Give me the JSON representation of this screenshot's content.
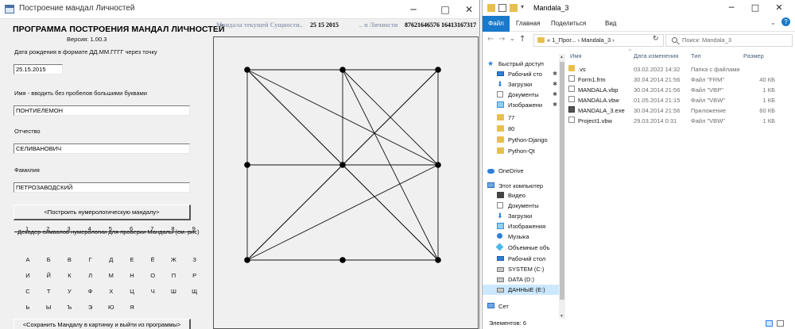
{
  "vb_window": {
    "title": "Построение мандал Личностей",
    "controls": {
      "minimize": "─",
      "maximize": "□",
      "close": "✕"
    },
    "heading": "ПРОГРАММА ПОСТРОЕНИЯ МАНДАЛ ЛИЧНОСТЕЙ",
    "version": "Версия: 1.00.3",
    "birth_label": "Дата рождения в формате ДД.ММ.ГГГГ через точку",
    "birth_value": "25.15.2015",
    "name_label": "Имя - вводить без пробелов большими буквами",
    "name_value": "ПОНТИЕЛЕМОН",
    "patronymic_label": "Отчество",
    "patronymic_value": "СЕЛИВАНОВИЧ",
    "surname_label": "Фамилия",
    "surname_value": "ПЕТРОЗАВОДСКИЙ",
    "build_button": "<Построить нумерологическую мандалу>",
    "decoder_label": "Декодер символов нумерологии для проверки Мандалы (см. рис)",
    "digits": [
      "1",
      "2",
      "3",
      "4",
      "5",
      "6",
      "7",
      "8",
      "9"
    ],
    "letters": [
      "А",
      "Б",
      "В",
      "Г",
      "Д",
      "Е",
      "Ё",
      "Ж",
      "З",
      "И",
      "Й",
      "К",
      "Л",
      "М",
      "Н",
      "О",
      "П",
      "Р",
      "С",
      "Т",
      "У",
      "Ф",
      "Х",
      "Ц",
      "Ч",
      "Ш",
      "Щ",
      "Ь",
      "Ы",
      "Ъ",
      "Э",
      "Ю",
      "Я"
    ],
    "save_button": "<Сохранить Мандалу в картинку и выйти из программы>",
    "top_label_1": "Мандала текущей Сущности..",
    "top_value_1": "25 15 2015",
    "top_label_2": ".. и Личности",
    "top_value_2": "87621646576 16413167317"
  },
  "mandala": {
    "nodes": [
      [
        0,
        0
      ],
      [
        1,
        0
      ],
      [
        2,
        0
      ],
      [
        0,
        1
      ],
      [
        1,
        1
      ],
      [
        2,
        1
      ],
      [
        0,
        2
      ],
      [
        1,
        2
      ],
      [
        2,
        2
      ]
    ],
    "edges": [
      [
        0,
        1
      ],
      [
        1,
        2
      ],
      [
        0,
        3
      ],
      [
        3,
        6
      ],
      [
        1,
        4
      ],
      [
        3,
        4
      ],
      [
        4,
        5
      ],
      [
        6,
        7
      ],
      [
        7,
        8
      ],
      [
        2,
        5
      ],
      [
        5,
        8
      ],
      [
        0,
        4
      ],
      [
        0,
        5
      ],
      [
        0,
        8
      ],
      [
        1,
        5
      ],
      [
        1,
        8
      ],
      [
        2,
        6
      ],
      [
        2,
        4
      ],
      [
        4,
        6
      ],
      [
        6,
        5
      ],
      [
        4,
        8
      ]
    ]
  },
  "explorer": {
    "title": "Mandala_3",
    "controls": {
      "minimize": "─",
      "maximize": "□",
      "close": "✕"
    },
    "ribbon": {
      "file": "Файл",
      "home": "Главная",
      "share": "Поделиться",
      "view": "Вид"
    },
    "nav": {
      "back": "←",
      "forward": "→",
      "recent": "⌄",
      "up": "↑"
    },
    "address": "« 1_Прог...  ›  Mandala_3  ›",
    "search_placeholder": "Поиск: Mandala_3",
    "columns": {
      "name": "Имя",
      "date": "Дата изменения",
      "type": "Тип",
      "size": "Размер"
    },
    "files": [
      {
        "name": ".vs",
        "date": "03.02.2022 14:32",
        "type": "Папка с файлами",
        "size": "",
        "kind": "folder"
      },
      {
        "name": "Form1.frm",
        "date": "30.04.2014 21:56",
        "type": "Файл \"FRM\"",
        "size": "40 КБ",
        "kind": "file"
      },
      {
        "name": "MANDALA.vbp",
        "date": "30.04.2014 21:56",
        "type": "Файл \"VBP\"",
        "size": "1 КБ",
        "kind": "file"
      },
      {
        "name": "MANDALA.vbw",
        "date": "01.05.2014 21:15",
        "type": "Файл \"VBW\"",
        "size": "1 КБ",
        "kind": "file"
      },
      {
        "name": "MANDALA_3.exe",
        "date": "30.04.2014 21:56",
        "type": "Приложение",
        "size": "60 КБ",
        "kind": "exe"
      },
      {
        "name": "Project1.vbw",
        "date": "29.03.2014 0:31",
        "type": "Файл \"VBW\"",
        "size": "1 КБ",
        "kind": "file"
      }
    ],
    "nav_items": [
      {
        "label": "Быстрый доступ",
        "icon": "star"
      },
      {
        "label": "Рабочий сто",
        "icon": "desk",
        "pin": true
      },
      {
        "label": "Загрузки",
        "icon": "down",
        "pin": true
      },
      {
        "label": "Документы",
        "icon": "doc",
        "pin": true
      },
      {
        "label": "Изображени",
        "icon": "img",
        "pin": true
      },
      {
        "label": "77",
        "icon": "folder"
      },
      {
        "label": "80",
        "icon": "folder"
      },
      {
        "label": "Python-Django",
        "icon": "folder"
      },
      {
        "label": "Python-Qt",
        "icon": "folder"
      },
      {
        "label": "OneDrive",
        "icon": "cloud"
      },
      {
        "label": "Этот компьютер",
        "icon": "pc"
      },
      {
        "label": "Видео",
        "icon": "video"
      },
      {
        "label": "Документы",
        "icon": "doc"
      },
      {
        "label": "Загрузки",
        "icon": "down"
      },
      {
        "label": "Изображения",
        "icon": "img"
      },
      {
        "label": "Музыка",
        "icon": "music"
      },
      {
        "label": "Объемные объ",
        "icon": "3d"
      },
      {
        "label": "Рабочий стол",
        "icon": "desk"
      },
      {
        "label": "SYSTEM (C:)",
        "icon": "drive"
      },
      {
        "label": "DATA (D:)",
        "icon": "drive"
      },
      {
        "label": "ДАННЫЕ (E:)",
        "icon": "drive"
      },
      {
        "label": "Сет",
        "icon": "pc"
      }
    ],
    "status": "Элементов: 6"
  }
}
